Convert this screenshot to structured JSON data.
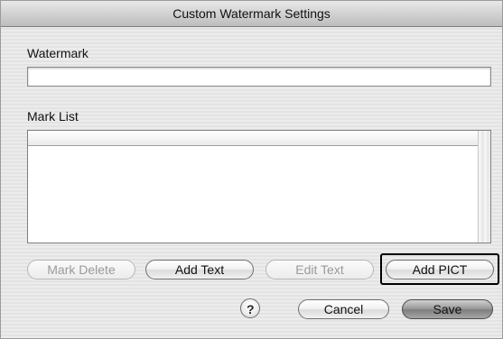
{
  "window": {
    "title": "Custom Watermark Settings"
  },
  "watermark": {
    "label": "Watermark",
    "value": ""
  },
  "mark_list": {
    "label": "Mark List",
    "items": []
  },
  "buttons": {
    "mark_delete": "Mark Delete",
    "add_text": "Add Text",
    "edit_text": "Edit Text",
    "add_pict": "Add PICT",
    "help": "?",
    "cancel": "Cancel",
    "save": "Save"
  },
  "states": {
    "mark_delete_enabled": false,
    "edit_text_enabled": false,
    "add_pict_highlighted": true,
    "save_is_default": true
  }
}
